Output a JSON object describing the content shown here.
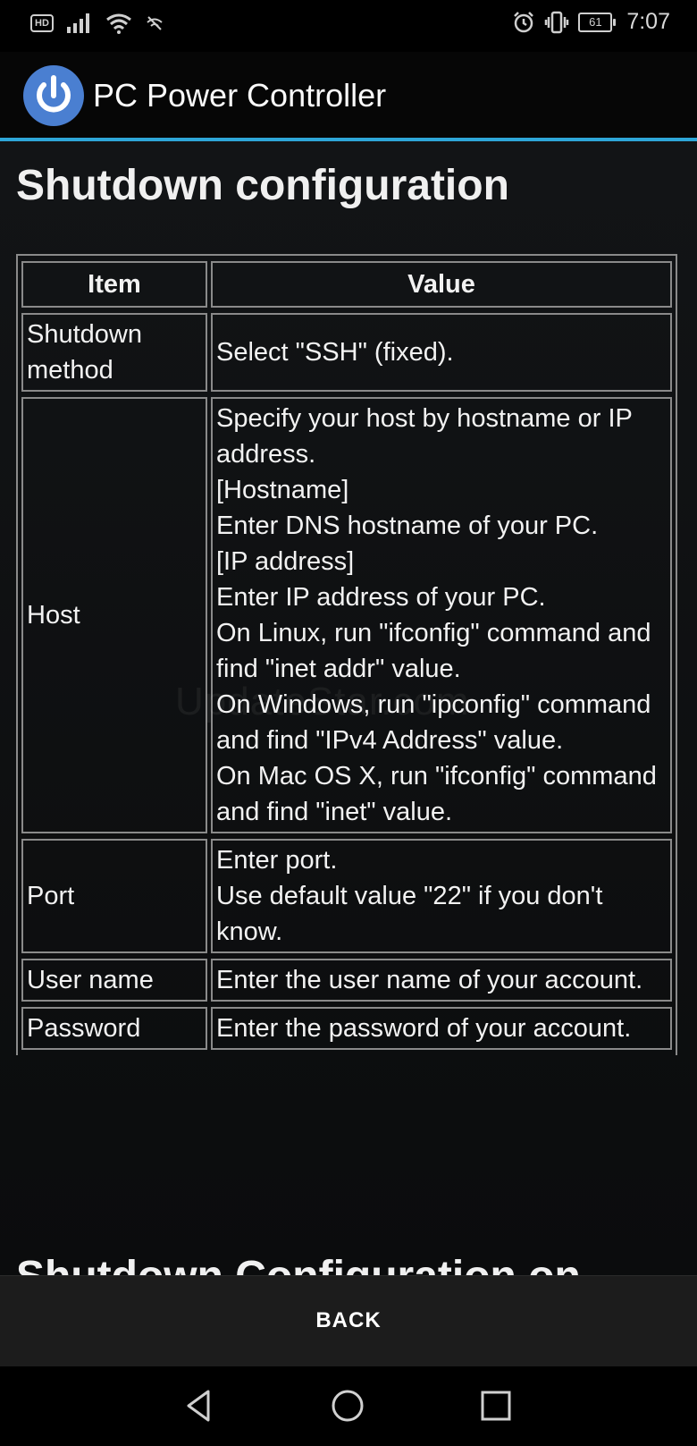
{
  "status_bar": {
    "hd_label": "HD",
    "battery_level": "61",
    "time": "7:07"
  },
  "app_bar": {
    "title": "PC Power Controller"
  },
  "page": {
    "title": "Shutdown configuration",
    "next_heading": "Shutdown Configuration on",
    "watermark": "UpdateStar.com"
  },
  "table": {
    "headers": [
      "Item",
      "Value"
    ],
    "rows": [
      {
        "item": "Shutdown method",
        "value_lines": [
          "Select \"SSH\" (fixed)."
        ]
      },
      {
        "item": "Host",
        "value_lines": [
          "Specify your host by hostname or IP address.",
          "[Hostname]",
          "Enter DNS hostname of your PC.",
          "[IP address]",
          "Enter IP address of your PC.",
          "On Linux, run \"ifconfig\" command and find \"inet addr\" value.",
          "On Windows, run \"ipconfig\" command and find \"IPv4 Address\" value.",
          "On Mac OS X, run \"ifconfig\" command and find \"inet\" value."
        ]
      },
      {
        "item": "Port",
        "value_lines": [
          "Enter port.",
          "Use default value \"22\" if you don't know."
        ]
      },
      {
        "item": "User name",
        "value_lines": [
          "Enter the user name of your account."
        ]
      },
      {
        "item": "Password",
        "value_lines": [
          "Enter the password of your account."
        ]
      }
    ]
  },
  "bottom_bar": {
    "back_label": "BACK"
  },
  "colors": {
    "accent": "#2ea6d8",
    "logo": "#4a7fd1",
    "table_border": "#8a8a8a",
    "background": "#121416"
  },
  "icons": {
    "signal": "signal-icon",
    "wifi": "wifi-icon",
    "alarm": "alarm-icon",
    "vibrate": "vibrate-icon",
    "power": "power-icon",
    "nav_back": "nav-back-icon",
    "nav_home": "nav-home-icon",
    "nav_recent": "nav-recent-icon"
  }
}
